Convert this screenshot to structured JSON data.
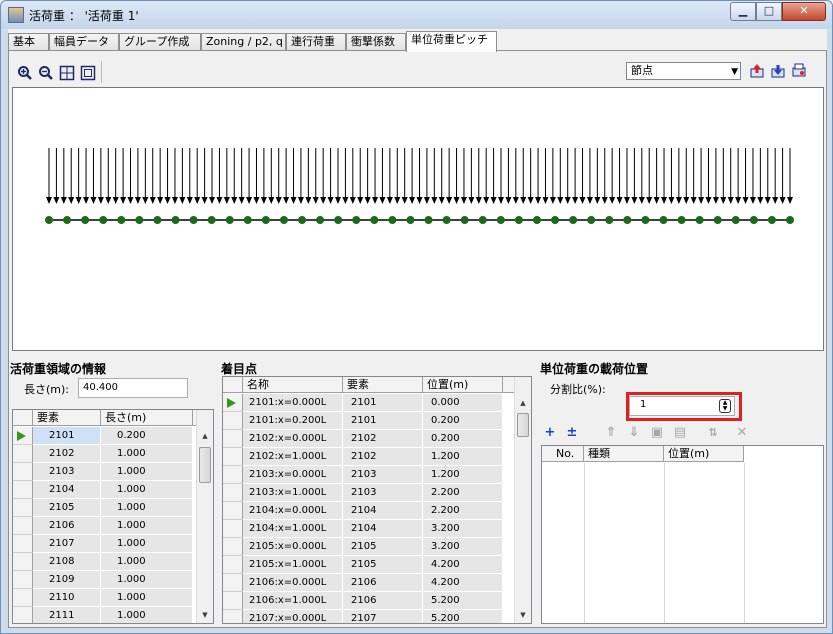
{
  "window": {
    "title": "活荷重 ： '活荷重 1'",
    "minimize_glyph": "▁",
    "maximize_glyph": "□",
    "close_glyph": "✕"
  },
  "tabs": [
    {
      "label": "基本"
    },
    {
      "label": "幅員データ"
    },
    {
      "label": "グループ作成"
    },
    {
      "label": "Zoning / p2, q"
    },
    {
      "label": "連行荷重"
    },
    {
      "label": "衝撃係数"
    },
    {
      "label": "単位荷重ピッチ"
    }
  ],
  "toolbar": {
    "icons": [
      "zoom-in-icon",
      "zoom-out-icon",
      "zoom-fit-icon",
      "zoom-window-icon"
    ],
    "view_mode": "節点",
    "right_icons": [
      "import-icon",
      "export-icon",
      "print-icon"
    ]
  },
  "left_panel": {
    "title": "活荷重領域の情報",
    "length_label": "長さ(m):",
    "length_value": "40.400",
    "columns": [
      "要素",
      "長さ(m)"
    ],
    "rows": [
      [
        "2101",
        "0.200"
      ],
      [
        "2102",
        "1.000"
      ],
      [
        "2103",
        "1.000"
      ],
      [
        "2104",
        "1.000"
      ],
      [
        "2105",
        "1.000"
      ],
      [
        "2106",
        "1.000"
      ],
      [
        "2107",
        "1.000"
      ],
      [
        "2108",
        "1.000"
      ],
      [
        "2109",
        "1.000"
      ],
      [
        "2110",
        "1.000"
      ],
      [
        "2111",
        "1.000"
      ]
    ]
  },
  "middle_panel": {
    "title": "着目点",
    "columns": [
      "名称",
      "要素",
      "位置(m)"
    ],
    "rows": [
      [
        "2101:x=0.000L",
        "2101",
        "0.000"
      ],
      [
        "2101:x=0.200L",
        "2101",
        "0.200"
      ],
      [
        "2102:x=0.000L",
        "2102",
        "0.200"
      ],
      [
        "2102:x=1.000L",
        "2102",
        "1.200"
      ],
      [
        "2103:x=0.000L",
        "2103",
        "1.200"
      ],
      [
        "2103:x=1.000L",
        "2103",
        "2.200"
      ],
      [
        "2104:x=0.000L",
        "2104",
        "2.200"
      ],
      [
        "2104:x=1.000L",
        "2104",
        "3.200"
      ],
      [
        "2105:x=0.000L",
        "2105",
        "3.200"
      ],
      [
        "2105:x=1.000L",
        "2105",
        "4.200"
      ],
      [
        "2106:x=0.000L",
        "2106",
        "4.200"
      ],
      [
        "2106:x=1.000L",
        "2106",
        "5.200"
      ],
      [
        "2107:x=0.000L",
        "2107",
        "5.200"
      ]
    ]
  },
  "right_panel": {
    "title": "単位荷重の載荷位置",
    "ratio_label": "分割比(%):",
    "ratio_value": "1",
    "columns": [
      "No.",
      "種類",
      "位置(m)"
    ],
    "toolbar_glyphs": {
      "add": "+",
      "insert": "±",
      "move_top": "⇑",
      "move_bottom": "⇓",
      "copy": "▣",
      "save": "▤",
      "sort": "⇅",
      "delete": "✕"
    }
  },
  "colors": {
    "load_arrow": "#000000",
    "beam": "#000000",
    "node": "#1a6a1a",
    "highlight": "#e02020",
    "row_marker": "#2e9c1a"
  }
}
